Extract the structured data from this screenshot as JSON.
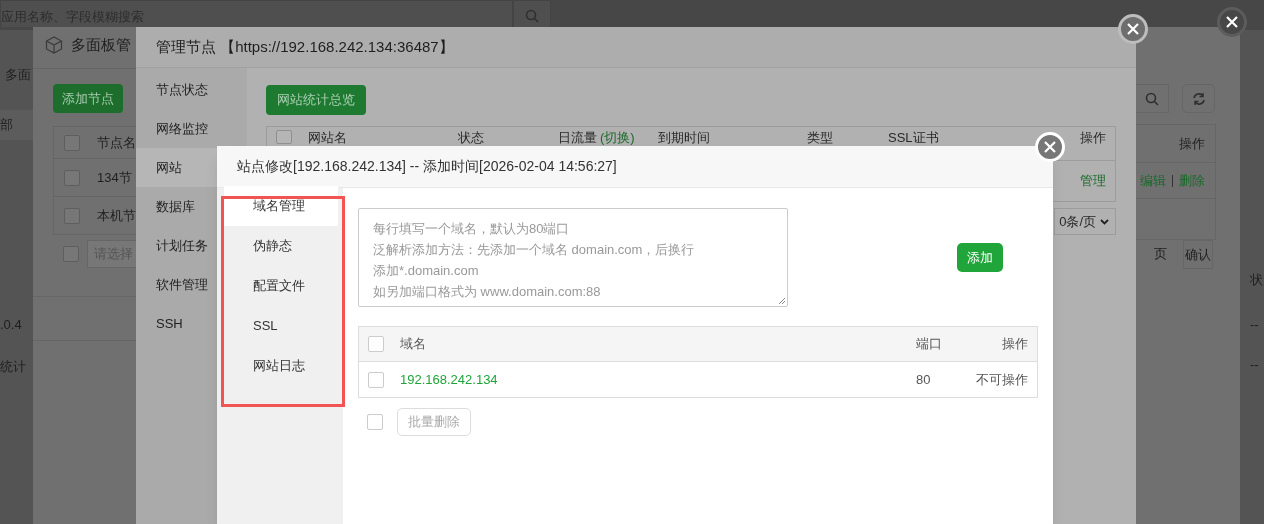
{
  "background_app": {
    "search_placeholder": "应用名称、字段模糊搜索",
    "left_labels": [
      "多面",
      "部",
      ".0.4",
      "统计"
    ],
    "right_labels": [
      "状",
      "--",
      "--"
    ]
  },
  "panel_window": {
    "title": "多面板管",
    "add_button": "添加节点",
    "header_checked": false,
    "column": "节点名",
    "rows": [
      {
        "label": "134节",
        "checked": false
      },
      {
        "label": "本机节",
        "checked": false
      }
    ],
    "batch_checked": false,
    "batch_placeholder": "请选择",
    "action_header": "操作",
    "row_actions": [
      "编辑",
      "删除"
    ],
    "page_label": "页",
    "confirm_button": "确认"
  },
  "node_window": {
    "title": "管理节点 【https://192.168.242.134:36487】",
    "menu": [
      {
        "label": "节点状态",
        "selected": false
      },
      {
        "label": "网络监控",
        "selected": false
      },
      {
        "label": "网站",
        "selected": true
      },
      {
        "label": "数据库",
        "selected": false
      },
      {
        "label": "计划任务",
        "selected": false
      },
      {
        "label": "软件管理",
        "selected": false
      },
      {
        "label": "SSH",
        "selected": false
      }
    ],
    "stats_button": "网站统计总览",
    "header_checked": false,
    "columns": [
      {
        "label": "网站名"
      },
      {
        "label": "状态"
      },
      {
        "label": "日流量",
        "link": "(切换)"
      },
      {
        "label": "到期时间"
      },
      {
        "label": "类型"
      },
      {
        "label": "SSL证书"
      },
      {
        "label": "操作"
      }
    ],
    "row_action": "管理",
    "page_size": "0条/页"
  },
  "site_dialog": {
    "title": "站点修改[192.168.242.134] -- 添加时间[2026-02-04 14:56:27]",
    "tabs": [
      {
        "label": "域名管理",
        "selected": true
      },
      {
        "label": "伪静态",
        "selected": false
      },
      {
        "label": "配置文件",
        "selected": false
      },
      {
        "label": "SSL",
        "selected": false
      },
      {
        "label": "网站日志",
        "selected": false
      }
    ],
    "domain_input": {
      "placeholder": [
        "每行填写一个域名，默认为80端口",
        "泛解析添加方法：先添加一个域名 domain.com，后换行添加*.domain.com",
        "如另加端口格式为 www.domain.com:88"
      ]
    },
    "add_button": "添加",
    "table": {
      "columns": [
        "域名",
        "端口",
        "操作"
      ],
      "header_checked": false,
      "rows": [
        {
          "domain": "192.168.242.134",
          "port": "80",
          "action": "不可操作",
          "checked": false
        }
      ]
    },
    "batch_checked": false,
    "batch_delete_button": "批量删除"
  }
}
